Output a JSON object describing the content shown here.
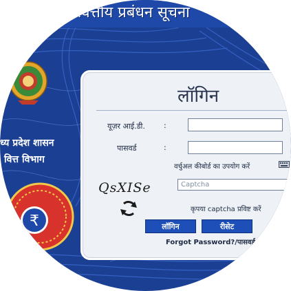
{
  "banner": {
    "title": "पूर्ति वित्तीय प्रबंधन सूचना"
  },
  "department": {
    "line1": "ध्य प्रदेश शासन",
    "line2": "वित्त विभाग"
  },
  "login": {
    "title": "लॉगिन",
    "user_id_label": "यूज़र आई.डी.",
    "password_label": "पासवर्ड",
    "colon": ":",
    "user_id_value": "",
    "password_value": "",
    "virtual_keyboard_label": "वर्चुअल कीबोर्ड का उपयोग करें",
    "captcha_text": "QsXISe",
    "captcha_placeholder": "Captcha",
    "captcha_hint": "कृपया captcha प्रविष्ट करें",
    "login_button": "लॉगिन",
    "reset_button": "रीसेट",
    "forgot_password": "Forgot Password?/पासवर्ड"
  },
  "colors": {
    "background_blue": "#1a3f93",
    "button_blue": "#1e4fb8",
    "panel": "#eef1f5",
    "emblem_gold": "#e3a52a",
    "badge_red": "#d8322c"
  }
}
